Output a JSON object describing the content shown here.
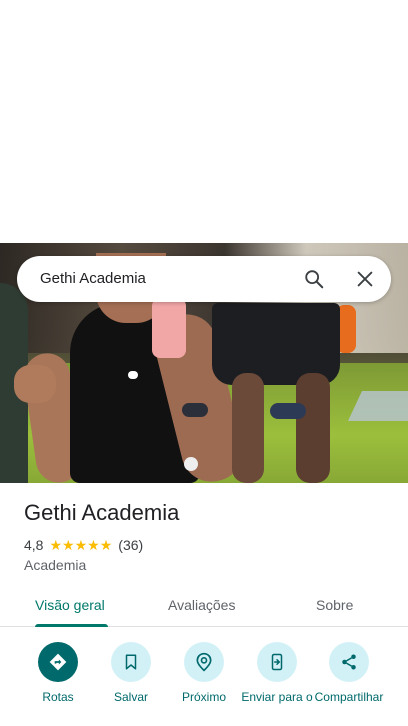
{
  "search": {
    "query": "Gethi Academia"
  },
  "place": {
    "name": "Gethi Academia",
    "rating": "4,8",
    "stars": 5,
    "reviews_count": "(36)",
    "category": "Academia"
  },
  "tabs": [
    {
      "label": "Visão geral",
      "active": true
    },
    {
      "label": "Avaliações",
      "active": false
    },
    {
      "label": "Sobre",
      "active": false
    }
  ],
  "actions": [
    {
      "label": "Rotas",
      "icon": "directions-icon"
    },
    {
      "label": "Salvar",
      "icon": "bookmark-icon"
    },
    {
      "label": "Próximo",
      "icon": "nearby-icon"
    },
    {
      "label": "Enviar para o",
      "icon": "send-to-phone-icon"
    },
    {
      "label": "Compartilhar",
      "icon": "share-icon"
    }
  ],
  "colors": {
    "accent": "#00796b",
    "action_bg": "#d2f1f7",
    "star": "#fbbc04"
  }
}
